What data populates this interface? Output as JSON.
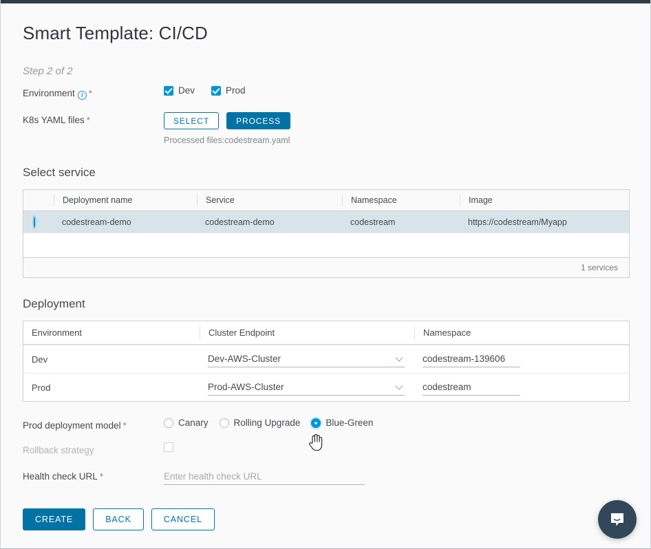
{
  "page": {
    "title": "Smart Template: CI/CD",
    "step": "Step 2 of 2"
  },
  "form": {
    "environment": {
      "label": "Environment",
      "info_icon": "info-icon",
      "required": "*",
      "options": [
        {
          "label": "Dev",
          "checked": true
        },
        {
          "label": "Prod",
          "checked": true
        }
      ]
    },
    "yaml": {
      "label": "K8s YAML files",
      "required": "*",
      "select_label": "SELECT",
      "process_label": "PROCESS",
      "processed_text": "Processed files:codestream.yaml"
    }
  },
  "select_service": {
    "heading": "Select service",
    "columns": [
      "Deployment name",
      "Service",
      "Namespace",
      "Image"
    ],
    "rows": [
      {
        "selected": true,
        "deployment_name": "codestream-demo",
        "service": "codestream-demo",
        "namespace": "codestream",
        "image": "https://codestream/Myapp"
      }
    ],
    "footer": "1 services"
  },
  "deployment": {
    "heading": "Deployment",
    "columns": [
      "Environment",
      "Cluster Endpoint",
      "Namespace"
    ],
    "rows": [
      {
        "environment": "Dev",
        "cluster_endpoint": "Dev-AWS-Cluster",
        "namespace": "codestream-139606"
      },
      {
        "environment": "Prod",
        "cluster_endpoint": "Prod-AWS-Cluster",
        "namespace": "codestream"
      }
    ]
  },
  "prod_model": {
    "label": "Prod deployment model",
    "required": "*",
    "options": [
      {
        "label": "Canary",
        "selected": false
      },
      {
        "label": "Rolling Upgrade",
        "selected": false
      },
      {
        "label": "Blue-Green",
        "selected": true
      }
    ]
  },
  "rollback": {
    "label": "Rollback strategy",
    "checked": false,
    "disabled": true
  },
  "health_check": {
    "label": "Health check URL",
    "required": "*",
    "value": "",
    "placeholder": "Enter health check URL"
  },
  "actions": {
    "create": "CREATE",
    "back": "BACK",
    "cancel": "CANCEL"
  },
  "chat_widget": {
    "icon": "chat-bubble-icon",
    "color": "#33475b"
  },
  "colors": {
    "accent": "#0072a3",
    "checkbox": "#0095d3",
    "required": "#c25b56",
    "topbar": "#313c44"
  }
}
